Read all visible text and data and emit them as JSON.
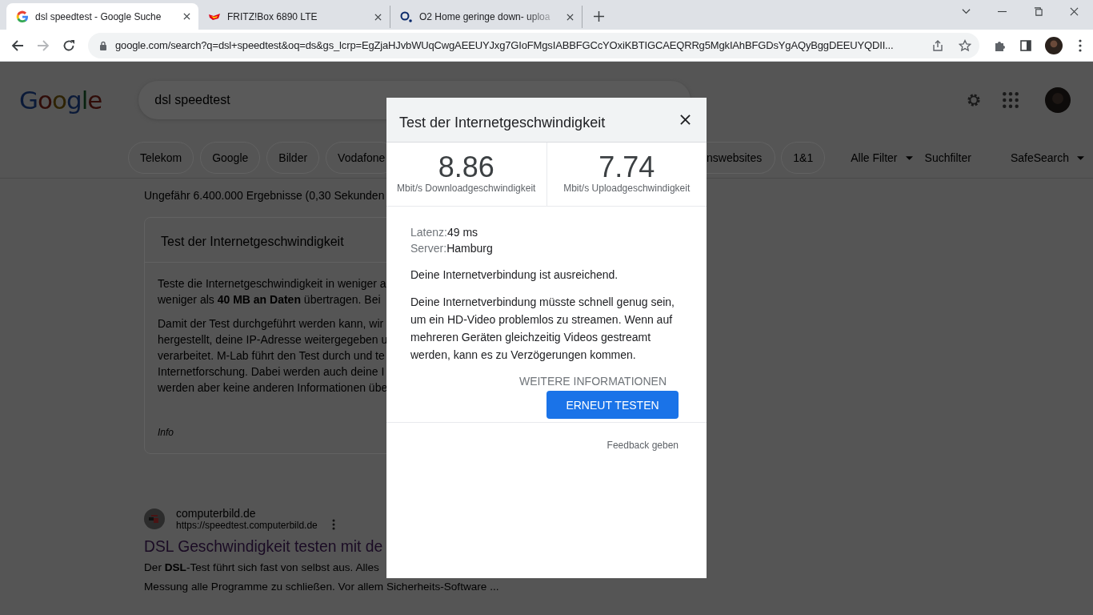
{
  "browser": {
    "tabs": [
      {
        "title": "dsl speedtest - Google Suche",
        "selected": true
      },
      {
        "title": "FRITZ!Box 6890 LTE",
        "selected": false
      },
      {
        "title": "O2 Home geringe down- uploa",
        "selected": false
      }
    ],
    "url": "google.com/search?q=dsl+speedtest&oq=ds&gs_lcrp=EgZjaHJvbWUqCwgAEEUYJxg7GIoFMgsIABBFGCcYOxiKBTIGCAEQRRg5MgkIAhBFGDsYgAQyBggDEEUYQDII..."
  },
  "google": {
    "logo": "Google",
    "query": "dsl speedtest",
    "chips": [
      {
        "label": "Telekom"
      },
      {
        "label": "Google"
      },
      {
        "label": "Bilder"
      },
      {
        "label": "Vodafone"
      }
    ],
    "chips_right": [
      {
        "label": "nswebsites"
      },
      {
        "label": "1&1"
      }
    ],
    "filters": [
      {
        "label": "Alle Filter",
        "dropdown": true
      },
      {
        "label": "Suchfilter",
        "dropdown": false
      },
      {
        "label": "SafeSearch",
        "dropdown": true
      }
    ],
    "result_count": "Ungefähr 6.400.000 Ergebnisse (0,30 Sekunden",
    "card": {
      "title": "Test der Internetgeschwindigkeit",
      "paragraphs": [
        [
          "Teste die Internetgeschwindigkeit in weniger a",
          "weniger als **40 MB an Daten** übertragen. Bei"
        ],
        [
          "Damit der Test durchgeführt werden kann, wir",
          "hergestellt, deine IP-Adresse weitergegeben u",
          "verarbeitet. M-Lab führt den Test durch und te",
          "Internetforschung. Dabei werden auch deine I",
          "werden aber keine anderen Informationen übe"
        ]
      ],
      "info": "Info"
    },
    "result": {
      "site": "computerbild.de",
      "url": "https://speedtest.computerbild.de",
      "title": "DSL Geschwindigkeit testen mit de",
      "snippet": [
        "Der **DSL**-Test führt sich fast von selbst aus. Alles",
        "Messung alle Programme zu schließen. Vor allem Sicherheits-Software ..."
      ]
    }
  },
  "dialog": {
    "title": "Test der Internetgeschwindigkeit",
    "speeds": [
      {
        "value": "8.86",
        "label": "Mbit/s Downloadgeschwindigkeit"
      },
      {
        "value": "7.74",
        "label": "Mbit/s Uploadgeschwindigkeit"
      }
    ],
    "details": [
      {
        "label": "Latenz:",
        "value": "49 ms"
      },
      {
        "label": "Server:",
        "value": "Hamburg"
      }
    ],
    "status": "Deine Internetverbindung ist ausreichend.",
    "message": "Deine Internetverbindung müsste schnell genug sein, um ein HD-Video problemlos zu streamen. Wenn auf mehreren Geräten gleichzeitig Videos gestreamt werden, kann es zu Verzögerungen kommen.",
    "more_link": "WEITERE INFORMATIONEN",
    "retest_button": "ERNEUT TESTEN",
    "feedback": "Feedback geben"
  }
}
